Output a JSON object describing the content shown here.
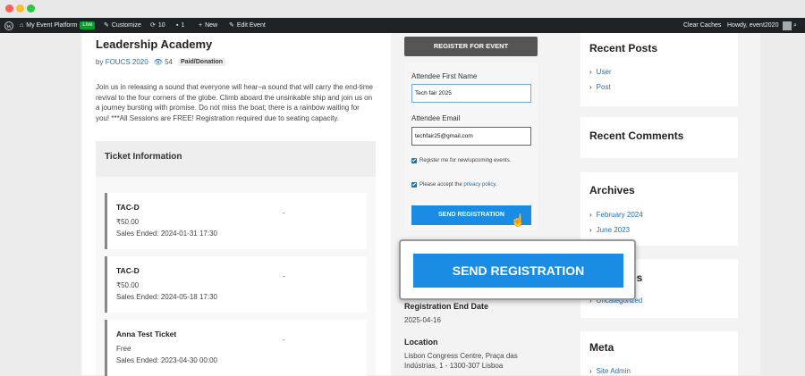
{
  "adminbar": {
    "site_name": "My Event Platform",
    "live_badge": "Live",
    "customize": "Customize",
    "updates_count": "10",
    "comments_count": "1",
    "new_label": "New",
    "edit_event": "Edit Event",
    "clear_caches": "Clear Caches",
    "howdy": "Howdy, event2020"
  },
  "event": {
    "title": "Leadership Academy",
    "by_label": "by",
    "author": "FOUCS 2020",
    "views": "54",
    "tag": "Paid/Donation",
    "description": "Join us in releasing a sound that everyone will hear–a sound that will carry the end-time revival to the four corners of the globe. Climb aboard the unsinkable ship and join us on a journey bursting with promise. Do not miss the boat; there is a rainbow waiting for you! ***All Sessions are FREE! Registration required due to seating capacity."
  },
  "tickets": {
    "heading": "Ticket Information",
    "items": [
      {
        "name": "TAC-D",
        "price": "₹50.00",
        "sales": "Sales Ended: 2024-01-31 17:30",
        "dash": "-"
      },
      {
        "name": "TAC-D",
        "price": "₹50.00",
        "sales": "Sales Ended: 2024-05-18 17:30",
        "dash": "-"
      },
      {
        "name": "Anna Test Ticket",
        "price": "Free",
        "sales": "Sales Ended: 2023-04-30 00:00",
        "dash": "-"
      }
    ]
  },
  "registration": {
    "register_button": "REGISTER FOR EVENT",
    "first_name_label": "Attendee First Name",
    "first_name_value": "Tech fair 2025",
    "email_label": "Attendee Email",
    "email_value": "techfair25@gmail.com",
    "newsletter_label": "Register me for new/upcoming events.",
    "privacy_prefix": "Please accept the",
    "privacy_link": "privacy policy",
    "privacy_suffix": ".",
    "send_button": "SEND REGISTRATION",
    "zoom_send_button": "SEND REGISTRATION"
  },
  "event_info": {
    "reg_end_label": "Registration End Date",
    "reg_end_value": "2025-04-16",
    "location_label": "Location",
    "location_line1": "Lisbon Congress Centre, Praça das",
    "location_line2": "Indústrias, 1 - 1300-307 Lisboa"
  },
  "sidebar": {
    "recent_posts_title": "Recent Posts",
    "recent_posts": [
      "User",
      "Post"
    ],
    "recent_comments_title": "Recent Comments",
    "archives_title": "Archives",
    "archives": [
      "February 2024",
      "June 2023"
    ],
    "categories_title_partial": "es",
    "categories_item": "Uncategorized",
    "meta_title": "Meta",
    "meta_item": "Site Admin"
  },
  "colors": {
    "accent": "#1b8ce3",
    "link": "#2271b1",
    "adminbar": "#1d2327"
  }
}
